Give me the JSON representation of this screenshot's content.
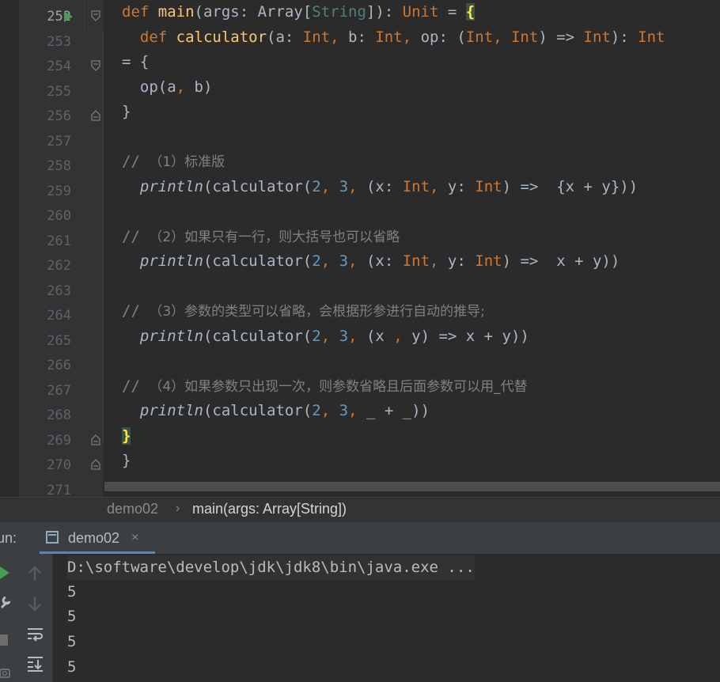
{
  "editor": {
    "line_numbers": [
      "252",
      "253",
      "254",
      "255",
      "256",
      "257",
      "258",
      "259",
      "260",
      "261",
      "262",
      "263",
      "264",
      "265",
      "266",
      "267",
      "268",
      "269",
      "270",
      "271"
    ],
    "lines": [
      [
        {
          "t": "def ",
          "c": "kw"
        },
        {
          "t": "main",
          "c": "fn"
        },
        {
          "t": "(args: "
        },
        {
          "t": "Array",
          "c": ""
        },
        {
          "t": "["
        },
        {
          "t": "String",
          "c": "ty"
        },
        {
          "t": "]): "
        },
        {
          "t": "Unit",
          "c": "kw"
        },
        {
          "t": " = "
        },
        {
          "t": "{",
          "c": "brace-hl"
        }
      ],
      [
        {
          "t": "  def ",
          "c": "kw"
        },
        {
          "t": "calculator",
          "c": "fn"
        },
        {
          "t": "(a: "
        },
        {
          "t": "Int",
          "c": "kw"
        },
        {
          "t": ", ",
          "c": "kw"
        },
        {
          "t": "b: "
        },
        {
          "t": "Int",
          "c": "kw"
        },
        {
          "t": ", ",
          "c": "kw"
        },
        {
          "t": "op: ("
        },
        {
          "t": "Int",
          "c": "kw"
        },
        {
          "t": ", ",
          "c": "kw"
        },
        {
          "t": "Int",
          "c": "kw"
        },
        {
          "t": ") => "
        },
        {
          "t": "Int",
          "c": "kw"
        },
        {
          "t": "): "
        },
        {
          "t": "Int",
          "c": "kw"
        }
      ],
      [
        {
          "t": "= {"
        }
      ],
      [
        {
          "t": "  op(a"
        },
        {
          "t": ", ",
          "c": "kw"
        },
        {
          "t": "b)"
        }
      ],
      [
        {
          "t": "}"
        }
      ],
      [],
      [
        {
          "t": "// ",
          "c": "cm"
        },
        {
          "t": "（1）标准版",
          "c": "cm cjk"
        }
      ],
      [
        {
          "t": "  "
        },
        {
          "t": "println",
          "c": "it"
        },
        {
          "t": "(calculator("
        },
        {
          "t": "2",
          "c": "num"
        },
        {
          "t": ", ",
          "c": "kw"
        },
        {
          "t": "3",
          "c": "num"
        },
        {
          "t": ", ",
          "c": "kw"
        },
        {
          "t": "(x: "
        },
        {
          "t": "Int",
          "c": "kw"
        },
        {
          "t": ", ",
          "c": "kw"
        },
        {
          "t": "y: "
        },
        {
          "t": "Int",
          "c": "kw"
        },
        {
          "t": ") =>  {x + y}))"
        }
      ],
      [],
      [
        {
          "t": "// ",
          "c": "cm"
        },
        {
          "t": "（2）如果只有一行，则大括号也可以省略",
          "c": "cm cjk"
        }
      ],
      [
        {
          "t": "  "
        },
        {
          "t": "println",
          "c": "it"
        },
        {
          "t": "(calculator("
        },
        {
          "t": "2",
          "c": "num"
        },
        {
          "t": ", ",
          "c": "kw"
        },
        {
          "t": "3",
          "c": "num"
        },
        {
          "t": ", ",
          "c": "kw"
        },
        {
          "t": "(x: "
        },
        {
          "t": "Int",
          "c": "kw"
        },
        {
          "t": ", ",
          "c": "kw"
        },
        {
          "t": "y: "
        },
        {
          "t": "Int",
          "c": "kw"
        },
        {
          "t": ") =>  x + y))"
        }
      ],
      [],
      [
        {
          "t": "// ",
          "c": "cm"
        },
        {
          "t": "（3）参数的类型可以省略，会根据形参进行自动的推导;",
          "c": "cm cjk"
        }
      ],
      [
        {
          "t": "  "
        },
        {
          "t": "println",
          "c": "it"
        },
        {
          "t": "(calculator("
        },
        {
          "t": "2",
          "c": "num"
        },
        {
          "t": ", ",
          "c": "kw"
        },
        {
          "t": "3",
          "c": "num"
        },
        {
          "t": ", ",
          "c": "kw"
        },
        {
          "t": "(x "
        },
        {
          "t": ", ",
          "c": "kw"
        },
        {
          "t": "y) => x + y))"
        }
      ],
      [],
      [
        {
          "t": "// ",
          "c": "cm"
        },
        {
          "t": "（4）如果参数只出现一次，则参数省略且后面参数可以用_代替",
          "c": "cm cjk"
        }
      ],
      [
        {
          "t": "  "
        },
        {
          "t": "println",
          "c": "it"
        },
        {
          "t": "(calculator("
        },
        {
          "t": "2",
          "c": "num"
        },
        {
          "t": ", ",
          "c": "kw"
        },
        {
          "t": "3",
          "c": "num"
        },
        {
          "t": ", ",
          "c": "kw"
        },
        {
          "t": "_ + _))"
        }
      ],
      [
        {
          "t": "}",
          "c": "brace-hl"
        }
      ],
      [
        {
          "t": "}"
        }
      ],
      []
    ]
  },
  "breadcrumb": {
    "items": [
      "demo02",
      "main(args: Array[String])"
    ],
    "separator": "›"
  },
  "run_panel": {
    "label": "un:",
    "tab_label": "demo02",
    "tab_close": "×"
  },
  "console": {
    "command": "D:\\software\\develop\\jdk\\jdk8\\bin\\java.exe ...",
    "outputs": [
      "5",
      "5",
      "5",
      "5"
    ]
  },
  "colors": {
    "keyword": "#cc7832",
    "function": "#ffc66d",
    "number": "#6897bb",
    "comment": "#808080",
    "run_green": "#499c54",
    "tab_underline": "#4a88c7"
  }
}
